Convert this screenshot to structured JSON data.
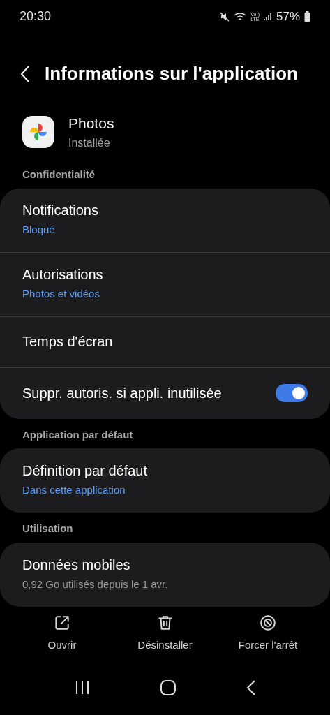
{
  "status_bar": {
    "time": "20:30",
    "volte_top": "Vo))",
    "volte_bottom": "LTE",
    "battery": "57%"
  },
  "header": {
    "title": "Informations sur l'application"
  },
  "app": {
    "name": "Photos",
    "status": "Installée"
  },
  "sections": [
    {
      "title": "Confidentialité",
      "items": [
        {
          "kind": "link",
          "label": "Notifications",
          "subtitle": "Bloqué"
        },
        {
          "kind": "link",
          "label": "Autorisations",
          "subtitle": "Photos et vidéos"
        },
        {
          "kind": "link",
          "label": "Temps d'écran"
        },
        {
          "kind": "toggle",
          "label": "Suppr. autoris. si appli. inutilisée",
          "on": true
        }
      ]
    },
    {
      "title": "Application par défaut",
      "items": [
        {
          "kind": "link",
          "label": "Définition par défaut",
          "subtitle": "Dans cette application"
        }
      ]
    },
    {
      "title": "Utilisation",
      "items": [
        {
          "kind": "info",
          "label": "Données mobiles",
          "subtitle": "0,92 Go utilisés depuis le 1 avr."
        }
      ]
    }
  ],
  "actions": [
    {
      "kind": "open",
      "label": "Ouvrir"
    },
    {
      "kind": "uninstall",
      "label": "Désinstaller"
    },
    {
      "kind": "stop",
      "label": "Forcer l'arrêt"
    }
  ]
}
